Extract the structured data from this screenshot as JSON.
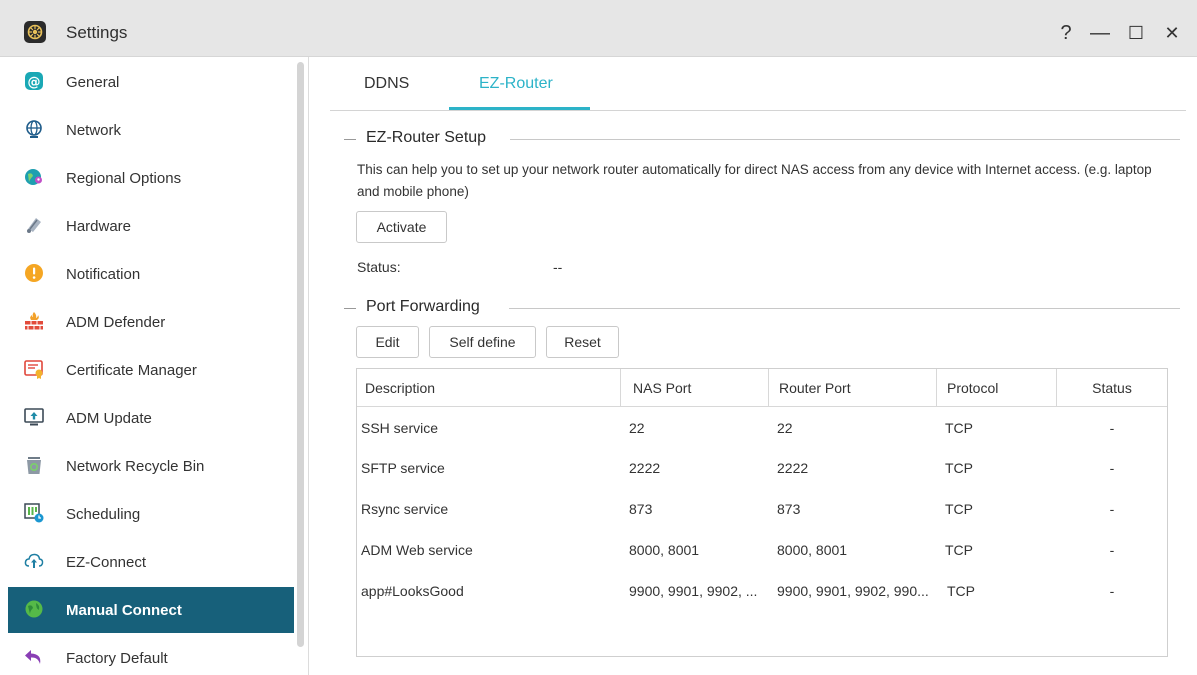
{
  "window": {
    "title": "Settings",
    "controls": {
      "help": "?",
      "minimize": "—",
      "maximize": "☐",
      "close": "✕"
    }
  },
  "sidebar": {
    "items": [
      {
        "label": "General",
        "icon": "general-icon"
      },
      {
        "label": "Network",
        "icon": "globe-icon"
      },
      {
        "label": "Regional Options",
        "icon": "globe-pin-icon"
      },
      {
        "label": "Hardware",
        "icon": "hardware-icon"
      },
      {
        "label": "Notification",
        "icon": "alert-icon"
      },
      {
        "label": "ADM Defender",
        "icon": "firewall-icon"
      },
      {
        "label": "Certificate Manager",
        "icon": "certificate-icon"
      },
      {
        "label": "ADM Update",
        "icon": "update-icon"
      },
      {
        "label": "Network Recycle Bin",
        "icon": "recycle-bin-icon"
      },
      {
        "label": "Scheduling",
        "icon": "scheduling-icon"
      },
      {
        "label": "EZ-Connect",
        "icon": "cloud-upload-icon"
      },
      {
        "label": "Manual Connect",
        "icon": "manual-connect-icon",
        "active": true
      },
      {
        "label": "Factory Default",
        "icon": "undo-icon"
      }
    ]
  },
  "tabs": [
    {
      "label": "DDNS",
      "active": false
    },
    {
      "label": "EZ-Router",
      "active": true
    }
  ],
  "ezrouter": {
    "section_title": "EZ-Router Setup",
    "description": "This can help you to set up your network router automatically for direct NAS access from any device with Internet access. (e.g. laptop and mobile phone)",
    "activate_label": "Activate",
    "status_label": "Status:",
    "status_value": "--"
  },
  "port_forwarding": {
    "section_title": "Port Forwarding",
    "buttons": {
      "edit": "Edit",
      "self_define": "Self define",
      "reset": "Reset"
    },
    "columns": [
      "Description",
      "NAS Port",
      "Router Port",
      "Protocol",
      "Status"
    ],
    "rows": [
      [
        "SSH service",
        "22",
        "22",
        "TCP",
        "-"
      ],
      [
        "SFTP service",
        "2222",
        "2222",
        "TCP",
        "-"
      ],
      [
        "Rsync service",
        "873",
        "873",
        "TCP",
        "-"
      ],
      [
        "ADM Web service",
        "8000, 8001",
        "8000, 8001",
        "TCP",
        "-"
      ],
      [
        "app#LooksGood",
        "9900, 9901, 9902, ...",
        "9900, 9901, 9902, 990...",
        "TCP",
        "-"
      ]
    ]
  },
  "colors": {
    "accent": "#2cb3c8",
    "sidebar_active": "#17607a"
  }
}
